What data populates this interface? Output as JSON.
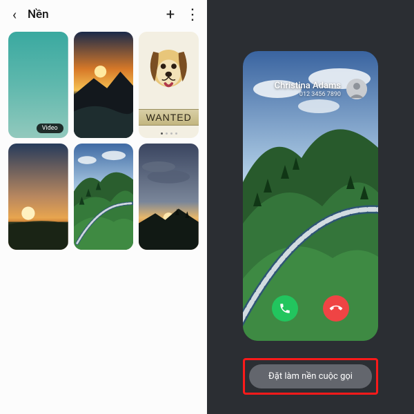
{
  "header": {
    "title": "Nền"
  },
  "thumbs": {
    "video_label": "Video",
    "wanted_label": "WANTED"
  },
  "call": {
    "name": "Christina Adams",
    "number": "012 3456 7890"
  },
  "set_button": "Đặt làm nền cuộc gọi"
}
